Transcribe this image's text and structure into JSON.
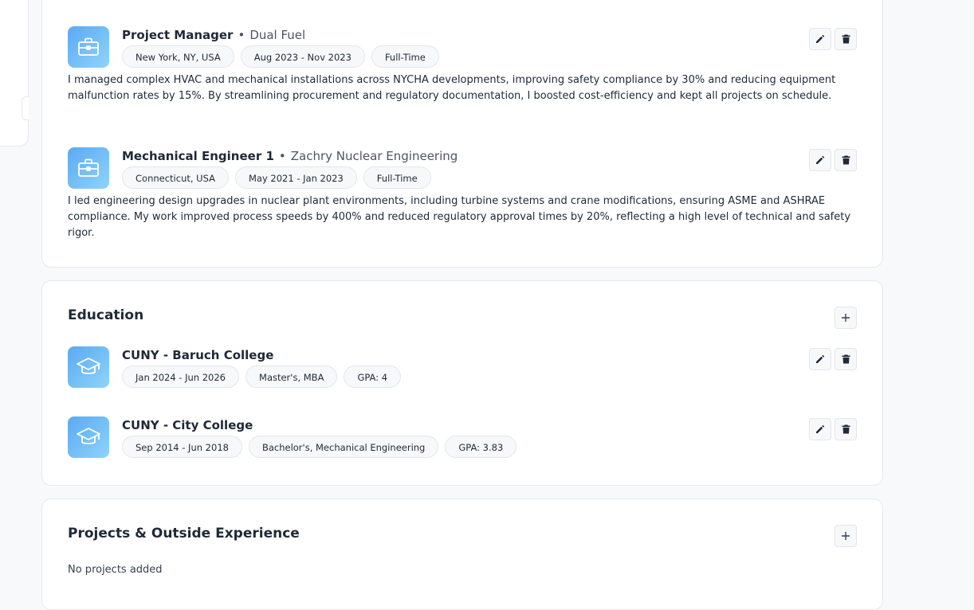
{
  "experience": [
    {
      "role": "Project Manager",
      "company": "Dual Fuel",
      "location": "New York, NY, USA",
      "dates": "Aug 2023 - Nov 2023",
      "type": "Full-Time",
      "description": "I managed complex HVAC and mechanical installations across NYCHA developments, improving safety compliance by 30% and reducing equipment malfunction rates by 15%. By streamlining procurement and regulatory documentation, I boosted cost-efficiency and kept all projects on schedule.",
      "logo_icon": "briefcase-icon"
    },
    {
      "role": "Mechanical Engineer 1",
      "company": "Zachry Nuclear Engineering",
      "location": "Connecticut, USA",
      "dates": "May 2021 - Jan 2023",
      "type": "Full-Time",
      "description": "I led engineering design upgrades in nuclear plant environments, including turbine systems and crane modifications, ensuring ASME and ASHRAE compliance. My work improved process speeds by 400% and reduced regulatory approval times by 20%, reflecting a high level of technical and safety rigor.",
      "logo_icon": "briefcase-icon"
    }
  ],
  "education": {
    "title": "Education",
    "items": [
      {
        "school": "CUNY - Baruch College",
        "dates": "Jan 2024 - Jun 2026",
        "degree": "Master's, MBA",
        "gpa": "GPA: 4",
        "logo_icon": "graduation-cap-icon"
      },
      {
        "school": "CUNY - City College",
        "dates": "Sep 2014 - Jun 2018",
        "degree": "Bachelor's, Mechanical Engineering",
        "gpa": "GPA: 3.83",
        "logo_icon": "graduation-cap-icon"
      }
    ]
  },
  "projects": {
    "title": "Projects & Outside Experience",
    "empty_text": "No projects added"
  },
  "dot": "•",
  "colors": {
    "logo_gradient_start": "#5aa9f3",
    "logo_gradient_end": "#8fd4fb",
    "card_border": "#e6e8ec",
    "page_background": "#f8f9fb"
  }
}
